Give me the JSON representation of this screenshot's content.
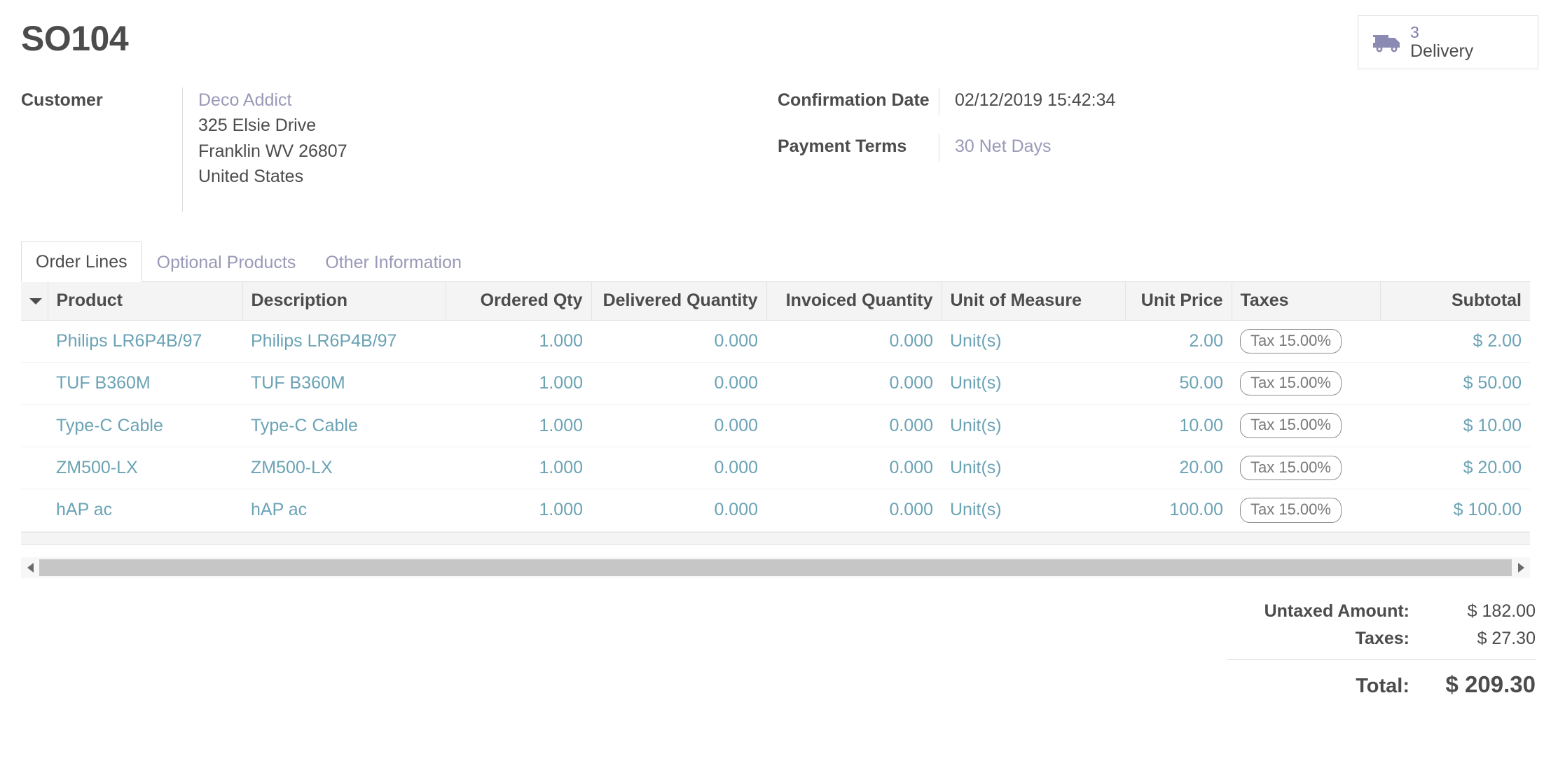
{
  "header": {
    "title": "SO104",
    "stat_buttons": [
      {
        "icon": "truck-icon",
        "value": "3",
        "label": "Delivery"
      }
    ]
  },
  "info": {
    "customer": {
      "label": "Customer",
      "name": "Deco Addict",
      "street": "325 Elsie Drive",
      "city_state_zip": "Franklin WV 26807",
      "country": "United States"
    },
    "confirmation_date": {
      "label": "Confirmation Date",
      "value": "02/12/2019 15:42:34"
    },
    "payment_terms": {
      "label": "Payment Terms",
      "value": "30 Net Days"
    }
  },
  "notebook": {
    "tabs": [
      {
        "label": "Order Lines",
        "active": true
      },
      {
        "label": "Optional Products",
        "active": false
      },
      {
        "label": "Other Information",
        "active": false
      }
    ]
  },
  "order_lines": {
    "columns": [
      "Product",
      "Description",
      "Ordered Qty",
      "Delivered Quantity",
      "Invoiced Quantity",
      "Unit of Measure",
      "Unit Price",
      "Taxes",
      "Subtotal"
    ],
    "rows": [
      {
        "product": "Philips LR6P4B/97",
        "description": "Philips LR6P4B/97",
        "ordered_qty": "1.000",
        "delivered_quantity": "0.000",
        "invoiced_quantity": "0.000",
        "unit_of_measure": "Unit(s)",
        "unit_price": "2.00",
        "taxes": "Tax 15.00%",
        "subtotal": "$ 2.00"
      },
      {
        "product": "TUF B360M",
        "description": "TUF B360M",
        "ordered_qty": "1.000",
        "delivered_quantity": "0.000",
        "invoiced_quantity": "0.000",
        "unit_of_measure": "Unit(s)",
        "unit_price": "50.00",
        "taxes": "Tax 15.00%",
        "subtotal": "$ 50.00"
      },
      {
        "product": "Type-C Cable",
        "description": "Type-C Cable",
        "ordered_qty": "1.000",
        "delivered_quantity": "0.000",
        "invoiced_quantity": "0.000",
        "unit_of_measure": "Unit(s)",
        "unit_price": "10.00",
        "taxes": "Tax 15.00%",
        "subtotal": "$ 10.00"
      },
      {
        "product": "ZM500-LX",
        "description": "ZM500-LX",
        "ordered_qty": "1.000",
        "delivered_quantity": "0.000",
        "invoiced_quantity": "0.000",
        "unit_of_measure": "Unit(s)",
        "unit_price": "20.00",
        "taxes": "Tax 15.00%",
        "subtotal": "$ 20.00"
      },
      {
        "product": "hAP ac",
        "description": "hAP ac",
        "ordered_qty": "1.000",
        "delivered_quantity": "0.000",
        "invoiced_quantity": "0.000",
        "unit_of_measure": "Unit(s)",
        "unit_price": "100.00",
        "taxes": "Tax 15.00%",
        "subtotal": "$ 100.00"
      }
    ]
  },
  "totals": {
    "untaxed_label": "Untaxed Amount:",
    "untaxed_value": "$ 182.00",
    "taxes_label": "Taxes:",
    "taxes_value": "$ 27.30",
    "total_label": "Total:",
    "total_value": "$ 209.30"
  },
  "colors": {
    "accent_purple": "#7c7bad",
    "link_muted": "#9999b8",
    "cell_text": "#6ba3b5",
    "label_text": "#4c4c4c",
    "header_bg": "#f4f4f5"
  }
}
